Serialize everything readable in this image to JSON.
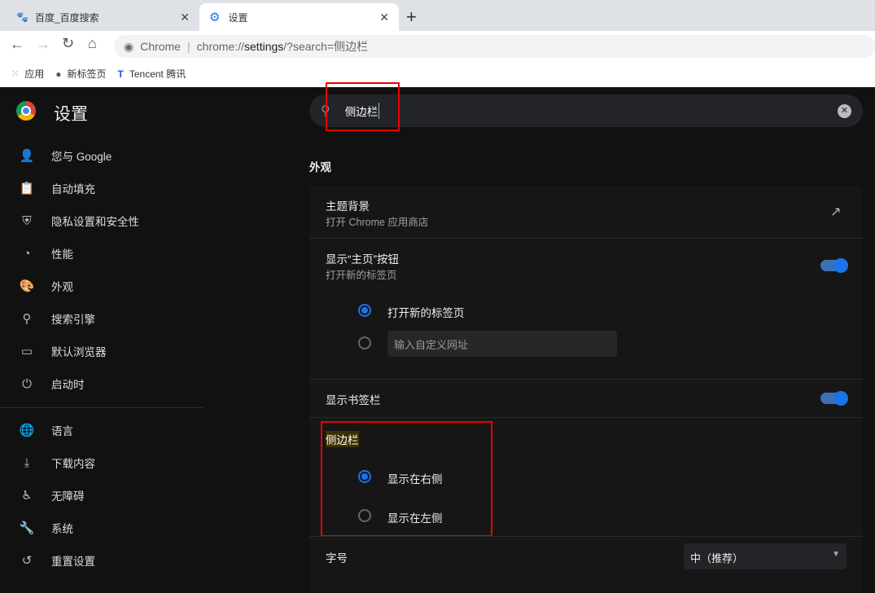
{
  "tabs": [
    {
      "title": "百度_百度搜索",
      "icon": "baidu-paw-icon",
      "active": false
    },
    {
      "title": "设置",
      "icon": "gear-icon",
      "active": true
    }
  ],
  "omnibox": {
    "site": "Chrome",
    "url_prefix": "chrome://",
    "url_host": "settings",
    "url_rest": "/?search=侧边栏"
  },
  "bookmarks": [
    {
      "label": "应用",
      "icon": "apps-grid-icon"
    },
    {
      "label": "新标签页",
      "icon": "globe-icon"
    },
    {
      "label": "Tencent 腾讯",
      "icon": "tencent-icon"
    }
  ],
  "settings": {
    "title": "设置",
    "nav": [
      {
        "label": "您与 Google",
        "icon": "person-icon"
      },
      {
        "label": "自动填充",
        "icon": "clipboard-icon"
      },
      {
        "label": "隐私设置和安全性",
        "icon": "shield-icon"
      },
      {
        "label": "性能",
        "icon": "speedometer-icon"
      },
      {
        "label": "外观",
        "icon": "palette-icon"
      },
      {
        "label": "搜索引擎",
        "icon": "search-icon"
      },
      {
        "label": "默认浏览器",
        "icon": "browser-icon"
      },
      {
        "label": "启动时",
        "icon": "power-icon"
      }
    ],
    "nav2": [
      {
        "label": "语言",
        "icon": "globe-icon"
      },
      {
        "label": "下载内容",
        "icon": "download-icon"
      },
      {
        "label": "无障碍",
        "icon": "accessibility-icon"
      },
      {
        "label": "系统",
        "icon": "wrench-icon"
      },
      {
        "label": "重置设置",
        "icon": "history-icon"
      }
    ],
    "search_value": "侧边栏",
    "section_title": "外观",
    "theme": {
      "title": "主题背景",
      "subtitle": "打开 Chrome 应用商店"
    },
    "home": {
      "title": "显示“主页”按钮",
      "subtitle": "打开新的标签页",
      "enabled": true,
      "options": [
        {
          "label": "打开新的标签页",
          "selected": true
        }
      ],
      "custom_placeholder": "输入自定义网址"
    },
    "bookmarks_bar": {
      "title": "显示书签栏",
      "enabled": true
    },
    "side_panel": {
      "title": "侧边栏",
      "options": [
        {
          "label": "显示在右侧",
          "selected": true
        },
        {
          "label": "显示在左侧",
          "selected": false
        }
      ]
    },
    "font_size": {
      "title": "字号",
      "value": "中（推荐）"
    }
  },
  "colors": {
    "accent": "#1a73e8",
    "highlight_box": "#e00000"
  }
}
